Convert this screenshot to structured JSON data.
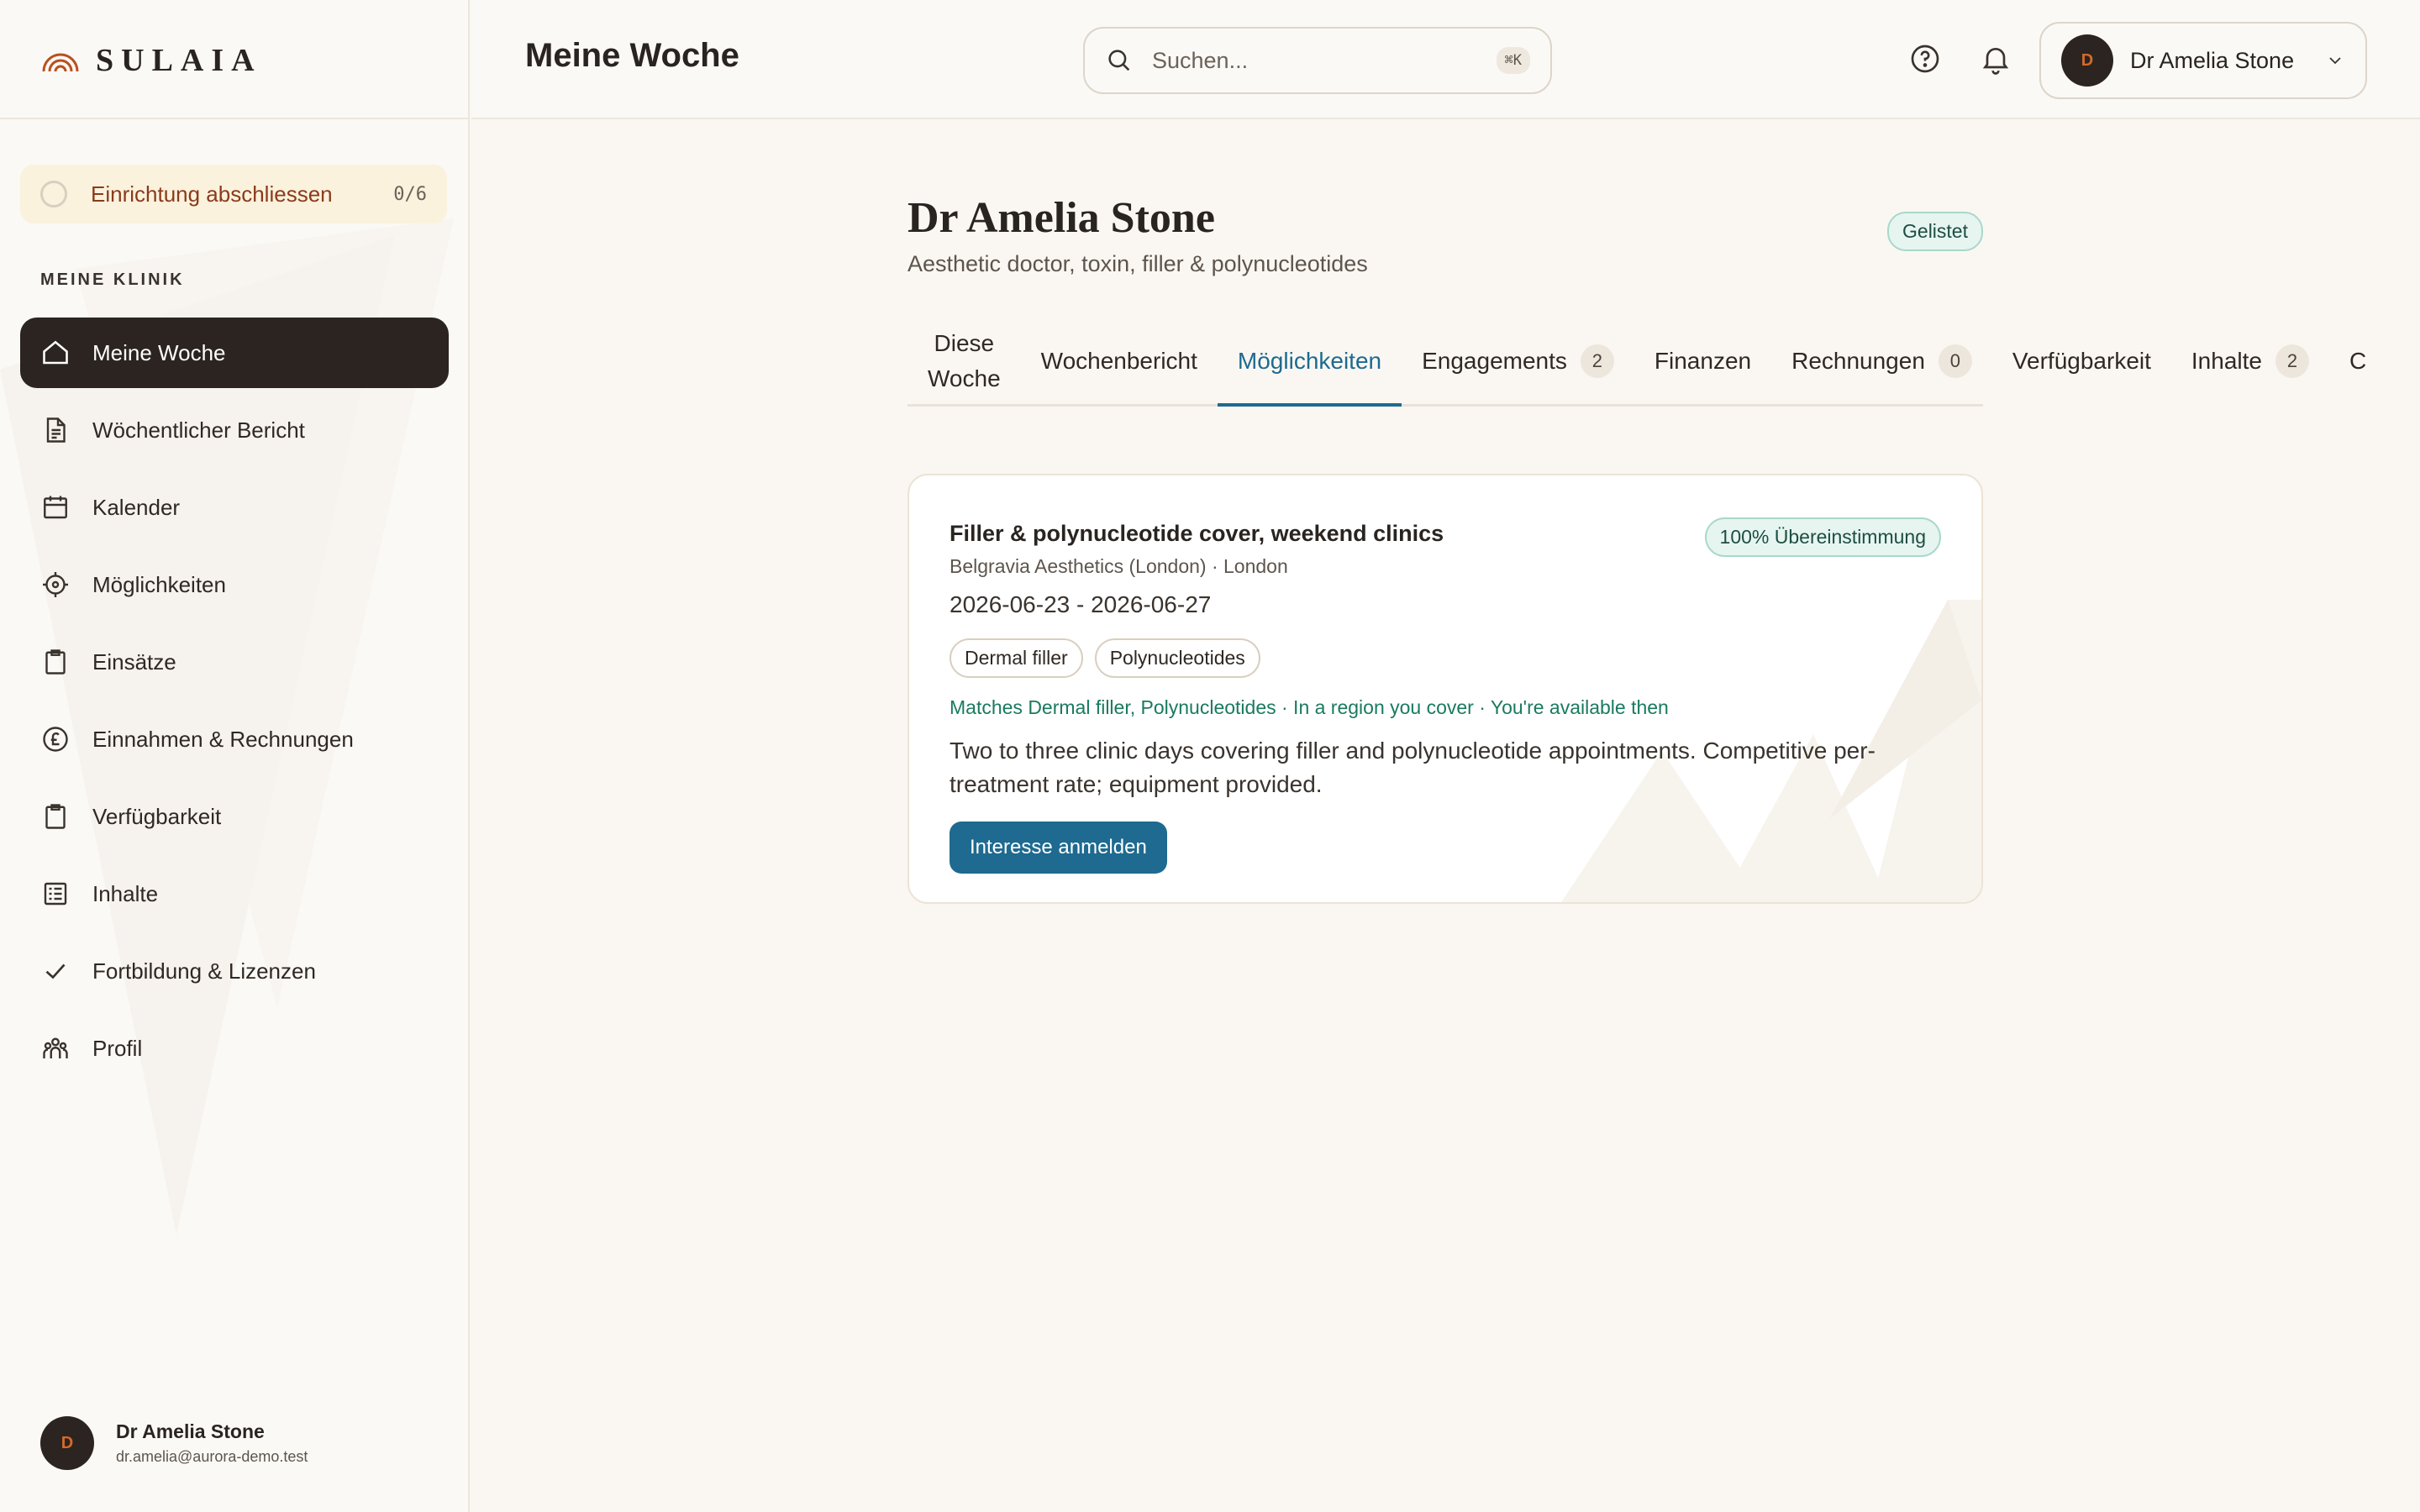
{
  "brand": {
    "name": "SULAIA"
  },
  "header": {
    "title": "Meine Woche",
    "search_placeholder": "Suchen...",
    "search_shortcut": "⌘K",
    "user_name": "Dr Amelia Stone",
    "user_initial": "D"
  },
  "sidebar": {
    "setup": {
      "label": "Einrichtung abschliessen",
      "progress": "0/6"
    },
    "section_label": "MEINE KLINIK",
    "items": [
      {
        "label": "Meine Woche",
        "icon": "home-icon",
        "active": true
      },
      {
        "label": "Wöchentlicher Bericht",
        "icon": "document-icon"
      },
      {
        "label": "Kalender",
        "icon": "calendar-icon"
      },
      {
        "label": "Möglichkeiten",
        "icon": "target-icon"
      },
      {
        "label": "Einsätze",
        "icon": "clipboard-icon"
      },
      {
        "label": "Einnahmen & Rechnungen",
        "icon": "pound-icon"
      },
      {
        "label": "Verfügbarkeit",
        "icon": "clipboard-icon"
      },
      {
        "label": "Inhalte",
        "icon": "list-icon"
      },
      {
        "label": "Fortbildung & Lizenzen",
        "icon": "check-icon"
      },
      {
        "label": "Profil",
        "icon": "people-icon"
      }
    ],
    "user": {
      "initial": "D",
      "name": "Dr Amelia Stone",
      "email": "dr.amelia@aurora-demo.test"
    }
  },
  "profile": {
    "name": "Dr Amelia Stone",
    "subtitle": "Aesthetic doctor, toxin, filler & polynucleotides",
    "status": "Gelistet"
  },
  "tabs": [
    {
      "label_line1": "Diese",
      "label_line2": "Woche"
    },
    {
      "label": "Wochenbericht"
    },
    {
      "label": "Möglichkeiten",
      "active": true
    },
    {
      "label": "Engagements",
      "count": "2"
    },
    {
      "label": "Finanzen"
    },
    {
      "label": "Rechnungen",
      "count": "0"
    },
    {
      "label": "Verfügbarkeit"
    },
    {
      "label": "Inhalte",
      "count": "2"
    },
    {
      "label": "C"
    }
  ],
  "opportunity": {
    "title": "Filler & polynucleotide cover, weekend clinics",
    "clinic": "Belgravia Aesthetics (London) · London",
    "dates": "2026-06-23 - 2026-06-27",
    "match": "100% Übereinstimmung",
    "tags": [
      "Dermal filler",
      "Polynucleotides"
    ],
    "match_reasons": "Matches Dermal filler, Polynucleotides · In a region you cover · You're available then",
    "description": "Two to three clinic days covering filler and polynucleotide appointments. Competitive per-treatment rate; equipment provided.",
    "action": "Interesse anmelden"
  },
  "colors": {
    "accent": "#1e6a90",
    "sidebar_active": "#2b2420",
    "match_green": "#1a7a5e",
    "setup_bg": "#fbf2dd",
    "brand_orange": "#b8501f"
  }
}
